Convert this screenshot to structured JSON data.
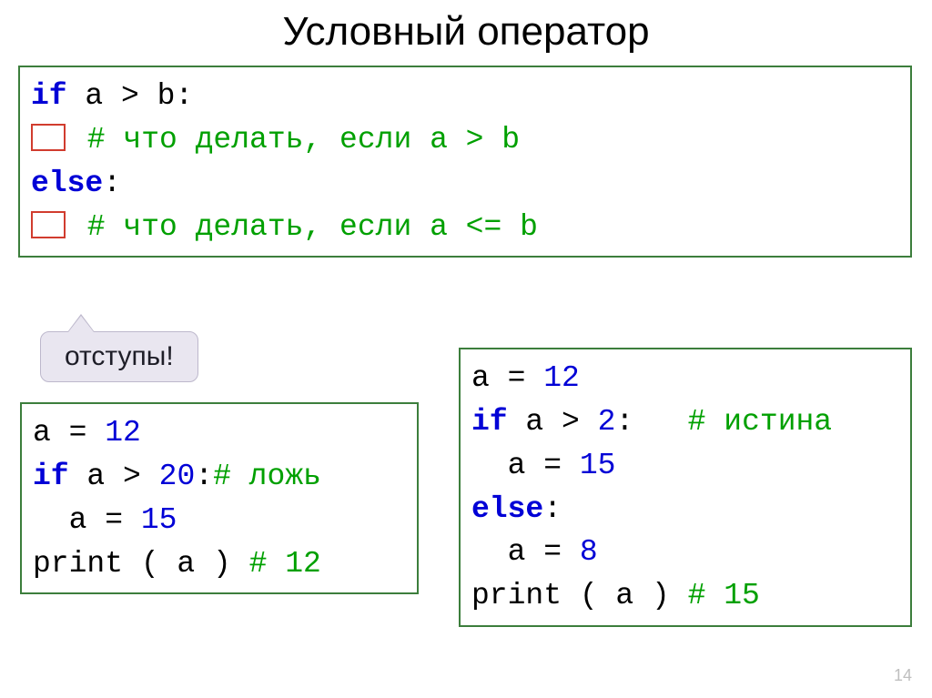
{
  "title": "Условный оператор",
  "callout": "отступы!",
  "page_number": "14",
  "box1": {
    "l1_kw": "if",
    "l1_rest": " a > b:",
    "l2": " # что делать, если a > b",
    "l3_kw": "else",
    "l3_rest": ":",
    "l4": " # что делать, если a <= b"
  },
  "box2": {
    "l1_a": "a = ",
    "l1_n": "12",
    "l2_kw": "if",
    "l2_rest": " a > ",
    "l2_n": "20",
    "l2_colon": ":",
    "l2_c": "# ложь",
    "l3_a": "  a = ",
    "l3_n": "15",
    "l4_p": "print ( a ) ",
    "l4_c": "# 12"
  },
  "box3": {
    "l1_a": "a = ",
    "l1_n": "12",
    "l2_kw": "if",
    "l2_rest": " a > ",
    "l2_n": "2",
    "l2_colon": ":   ",
    "l2_c": "# истина",
    "l3_a": "  a = ",
    "l3_n": "15",
    "l4_kw": "else",
    "l4_rest": ":",
    "l5_a": "  a = ",
    "l5_n": "8",
    "l6_p": "print ( a ) ",
    "l6_c": "# 15"
  }
}
